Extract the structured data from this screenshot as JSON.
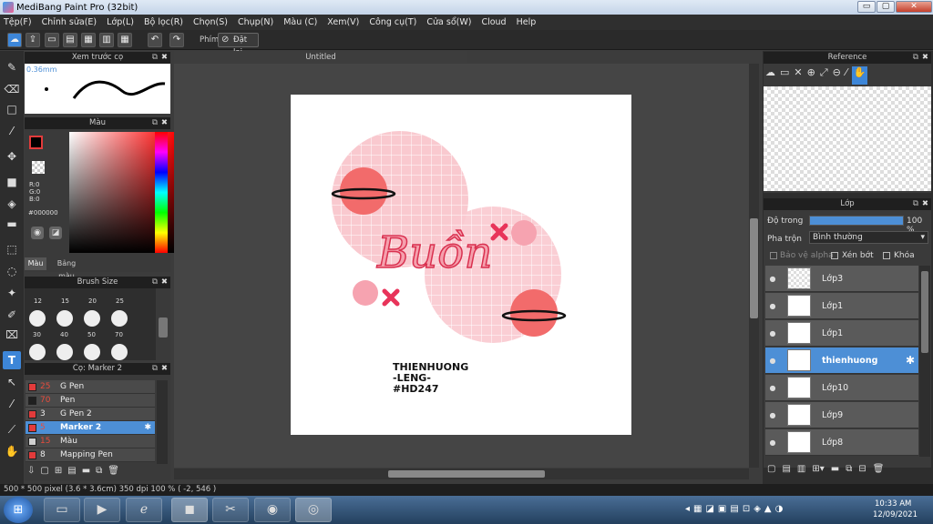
{
  "window": {
    "title": "MediBang Paint Pro (32bit)",
    "min": "▭",
    "max": "▢",
    "close": "✕"
  },
  "menu": [
    "Tệp(F)",
    "Chỉnh sửa(E)",
    "Lớp(L)",
    "Bộ lọc(R)",
    "Chọn(S)",
    "Chụp(N)",
    "Màu (C)",
    "Xem(V)",
    "Công cụ(T)",
    "Cửa sổ(W)",
    "Cloud",
    "Help"
  ],
  "toolbar": {
    "key_label": "Phím",
    "reset_label": "Đặt lại"
  },
  "brush_preview": {
    "title": "Xem trước cọ",
    "size": "0.36mm"
  },
  "color_panel": {
    "title": "Màu",
    "r": "R:0",
    "g": "G:0",
    "b": "B:0",
    "hex": "#000000",
    "tab_color": "Màu",
    "tab_palette": "Bảng màu"
  },
  "brush_size_panel": {
    "title": "Brush Size",
    "row1": [
      "12",
      "15",
      "20",
      "25"
    ],
    "row2": [
      "30",
      "40",
      "50",
      "70"
    ]
  },
  "brush_panel": {
    "title": "Cọ: Marker 2",
    "brushes": [
      {
        "size": "25",
        "name": "G Pen",
        "color": "#e23b3b"
      },
      {
        "size": "70",
        "name": "Pen",
        "color": "#202020"
      },
      {
        "size": "3",
        "name": "G Pen 2",
        "color": "#e23b3b"
      },
      {
        "size": "5",
        "name": "Marker 2",
        "color": "#e23b3b"
      },
      {
        "size": "15",
        "name": "Màu",
        "color": "#d0d0d0"
      },
      {
        "size": "8",
        "name": "Mapping Pen",
        "color": "#e23b3b"
      }
    ]
  },
  "document": {
    "tab": "Untitled"
  },
  "artwork": {
    "title": "Buồn",
    "credit1": "THIENHUONG",
    "credit2": "-LENG-",
    "credit3": "#HD247"
  },
  "reference_panel": {
    "title": "Reference"
  },
  "layer_panel": {
    "title": "Lớp",
    "opacity_label": "Độ trong",
    "opacity_value": "100 %",
    "opacity_fraction": 1.0,
    "blend_label": "Pha trộn",
    "blend_value": "Bình thường",
    "protect_alpha": "Bảo vệ alpha",
    "clipping": "Xén bớt",
    "lock": "Khóa",
    "layers": [
      {
        "name": "Lớp3"
      },
      {
        "name": "Lớp1"
      },
      {
        "name": "Lớp1"
      },
      {
        "name": "thienhuong"
      },
      {
        "name": "Lớp10"
      },
      {
        "name": "Lớp9"
      },
      {
        "name": "Lớp8"
      }
    ]
  },
  "status": {
    "text": "500 * 500 pixel  (3.6 * 3.6cm)  350 dpi  100 %  ( -2, 546 )"
  },
  "taskbar": {
    "time": "10:33 AM",
    "date": "12/09/2021"
  },
  "colors": {
    "pink": "#f9c9cf",
    "coral": "#f26b6b",
    "red": "#e8345a",
    "accent": "#4d8fd6"
  }
}
